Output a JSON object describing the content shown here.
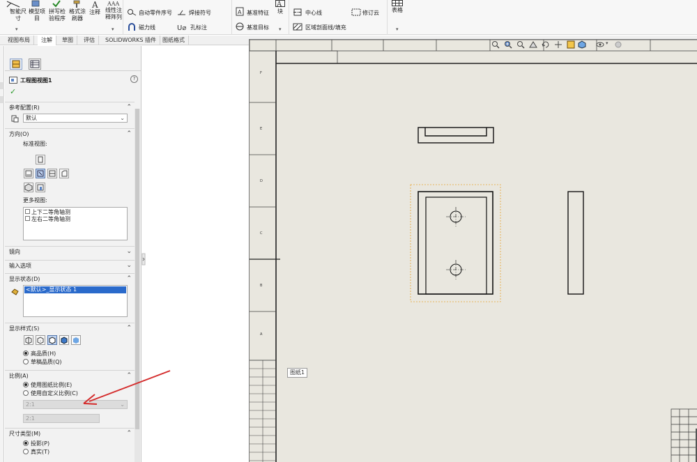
{
  "ribbon": {
    "smart_dim": [
      "智能尺",
      "寸"
    ],
    "model_items": [
      "模型项",
      "目"
    ],
    "spell_check": [
      "拼写检",
      "验程序"
    ],
    "format_painter": [
      "格式涂",
      "刷器"
    ],
    "note": "注释",
    "linear_note_pattern": [
      "线性注",
      "释阵列"
    ],
    "auto_balloon": "自动零件序号",
    "magnetic_line": "磁力线",
    "weld_symbol": "焊接符号",
    "hole_callout": "孔标注",
    "datum_feature": "基准特征",
    "datum_target": "基准目标",
    "block": "块",
    "centerline": "中心线",
    "area_hatch": "区域剖面线/填充",
    "revision_cloud": "修订云",
    "table": "表格"
  },
  "tabs": [
    "视图布局",
    "注解",
    "草图",
    "评估",
    "SOLIDWORKS 插件",
    "图纸格式"
  ],
  "active_tab": 1,
  "pm": {
    "title": "工程图视图1",
    "help": "?",
    "ok": "✓",
    "ref_config": {
      "header": "参考配置(R)",
      "value": "默认"
    },
    "orientation": {
      "header": "方向(O)",
      "standard_views_label": "标准视图:",
      "more_views_label": "更多视图:",
      "more_views": [
        "上下二等角轴测",
        "左右二等角轴测"
      ]
    },
    "mirror": {
      "header": "镜向"
    },
    "import_options": {
      "header": "输入选项"
    },
    "display_state": {
      "header": "显示状态(D)",
      "item": "<默认>_显示状态 1"
    },
    "display_style": {
      "header": "显示样式(S)",
      "high_quality": "高品质(H)",
      "draft_quality": "草稿品质(Q)"
    },
    "scale": {
      "header": "比例(A)",
      "use_sheet": "使用图纸比例(E)",
      "use_custom": "使用自定义比例(C)",
      "custom_value": "2:1",
      "custom_text": "2:1"
    },
    "dim_type": {
      "header": "尺寸类型(M)",
      "projected": "投影(P)",
      "true": "真实(T)"
    }
  },
  "sheet": {
    "tooltip": "图纸1",
    "left_zone_letters": [
      "F",
      "E",
      "D",
      "C",
      "B",
      "A"
    ]
  },
  "colors": {
    "sheet_bg": "#e9e7df",
    "selection_box": "#e8a431",
    "annotation_arrow": "#d42c2c",
    "tab_active": "#ffffff"
  }
}
